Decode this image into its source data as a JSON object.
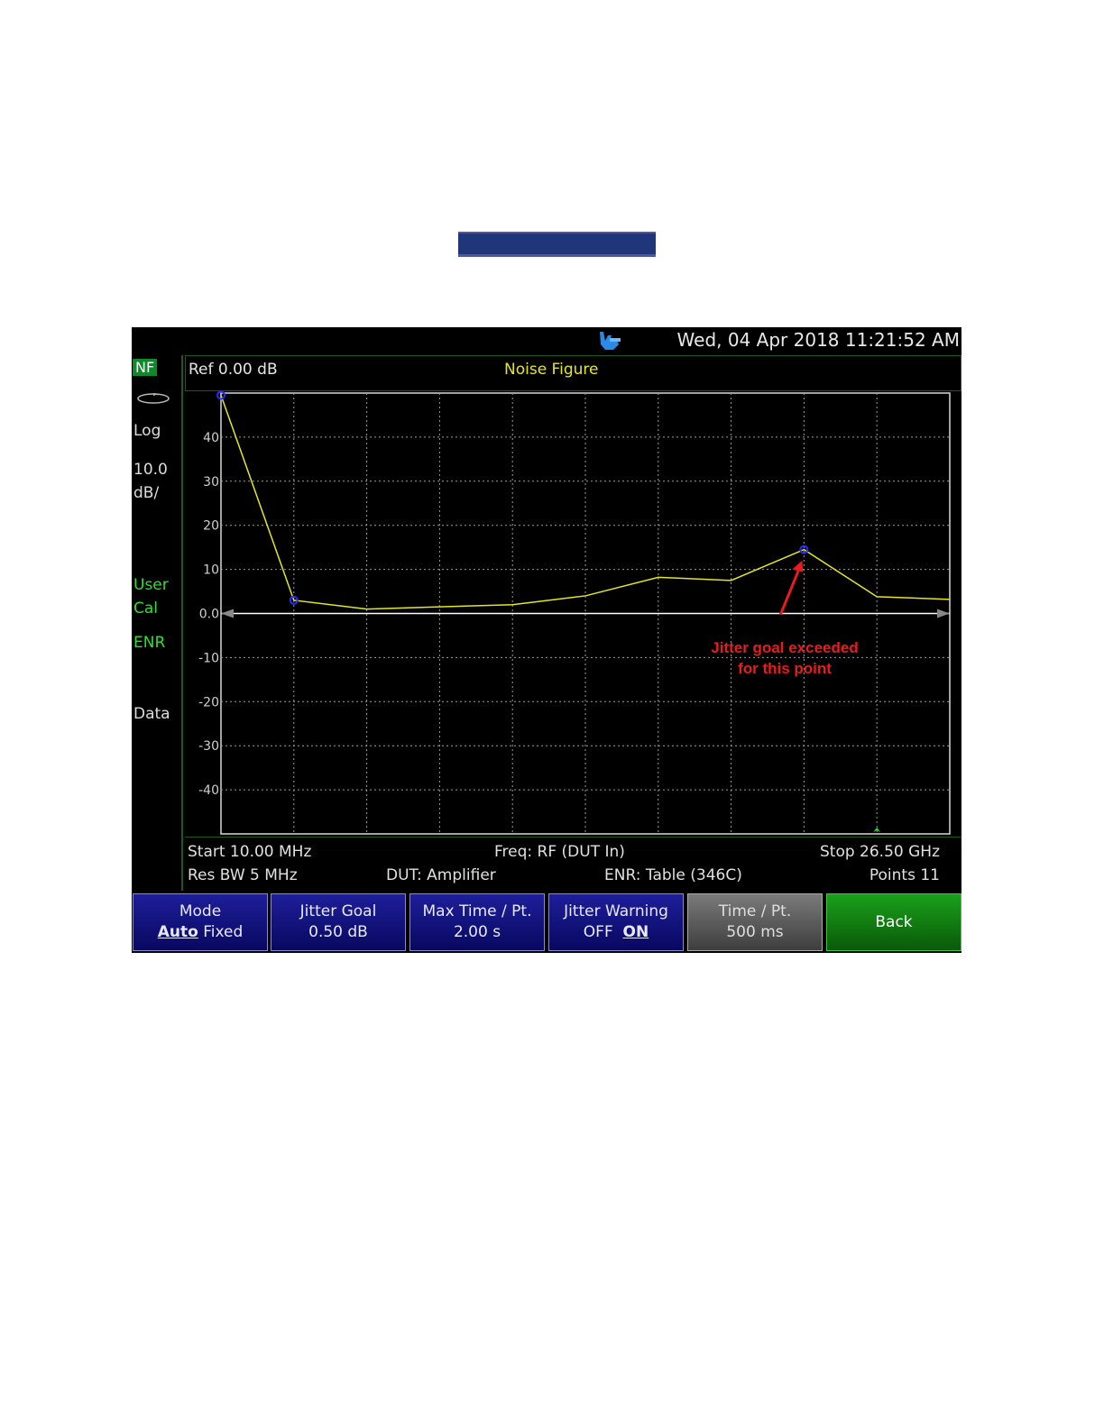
{
  "analyzer": {
    "datetime": "Wed, 04 Apr 2018 11:21:52 AM",
    "left_panel": {
      "measurement_badge": "NF",
      "scale_type": "Log",
      "scale_value": "10.0",
      "scale_unit": "dB/",
      "user_line1": "User",
      "user_line2": "Cal",
      "enr": "ENR",
      "data": "Data"
    },
    "header": {
      "reference": "Ref 0.00 dB",
      "trace_title": "Noise Figure"
    },
    "footer": {
      "start": "Start 10.00 MHz",
      "freq": "Freq: RF (DUT In)",
      "stop": "Stop 26.50 GHz",
      "res_bw": "Res BW 5 MHz",
      "dut": "DUT: Amplifier",
      "enr": "ENR: Table (346C)",
      "points": "Points 11"
    },
    "softkeys": {
      "mode": {
        "label": "Mode",
        "opt_selected": "Auto",
        "opt_other": "Fixed"
      },
      "jitter_goal": {
        "label": "Jitter Goal",
        "value": "0.50 dB"
      },
      "max_time": {
        "label": "Max Time / Pt.",
        "value": "2.00 s"
      },
      "jitter_warning": {
        "label": "Jitter Warning",
        "opt_other": "OFF",
        "opt_selected": "ON"
      },
      "time_per_point": {
        "label": "Time / Pt.",
        "value": "500 ms"
      },
      "back": {
        "label": "Back"
      }
    },
    "annotation": {
      "line1": "Jitter goal exceeded",
      "line2": "for this point",
      "color": "#e81c1c"
    }
  },
  "chart_data": {
    "type": "line",
    "x": [
      1,
      2,
      3,
      4,
      5,
      6,
      7,
      8,
      9,
      10,
      11
    ],
    "y_ticks": [
      40,
      30,
      20,
      10,
      0,
      -10,
      -20,
      -30,
      -40
    ],
    "y_tick_labels": [
      "40",
      "30",
      "20",
      "10",
      "0.0",
      "-10",
      "-20",
      "-30",
      "-40"
    ],
    "ylim": [
      -50,
      50
    ],
    "series": [
      {
        "values": [
          49.5,
          3,
          1,
          1.5,
          2,
          4,
          8.2,
          7.5,
          14.5,
          3.8,
          3.2
        ],
        "color": "#e6e620"
      }
    ],
    "markers": [
      1,
      2,
      9
    ],
    "marker_color": "#2a2aff",
    "reference_line": 0,
    "grid": true
  }
}
